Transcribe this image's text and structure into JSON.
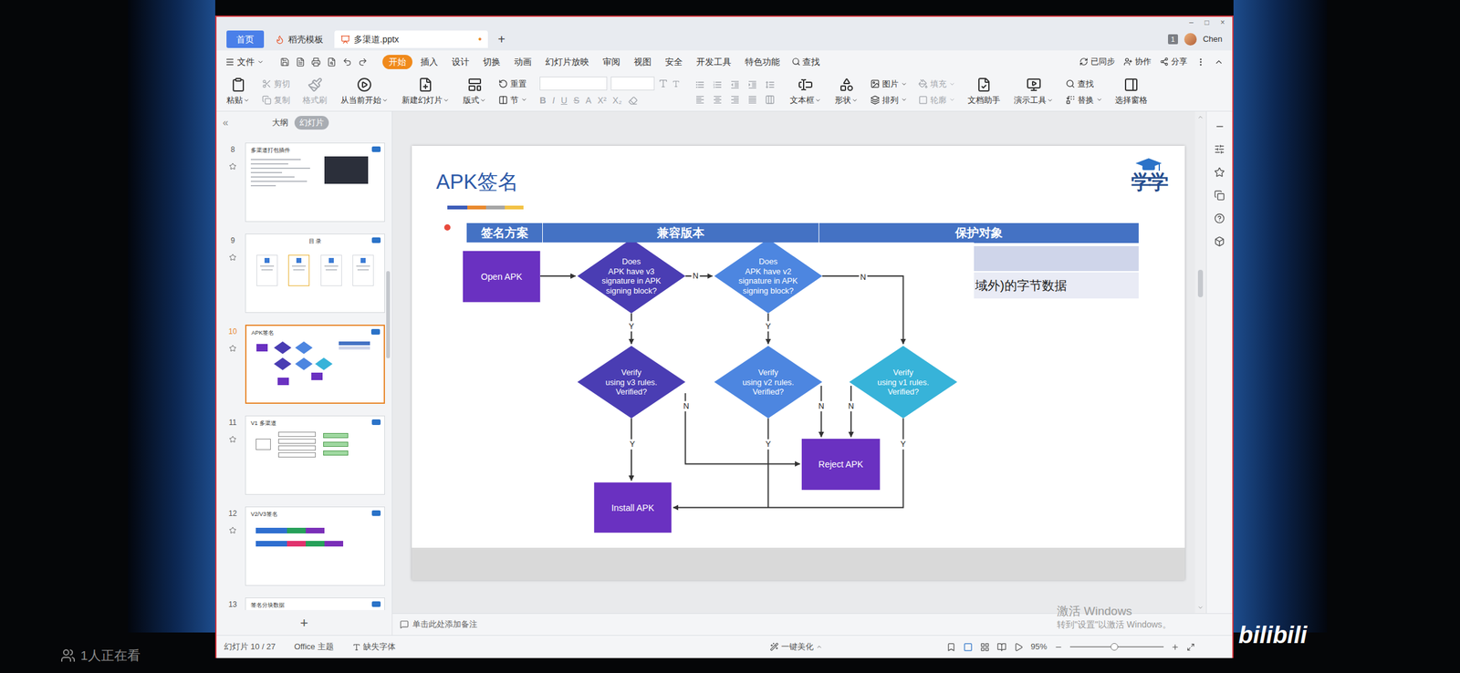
{
  "stream": {
    "viewers": "1人正在看",
    "logo": "bilibili",
    "watermark": [
      "激活 Windows",
      "转到\"设置\"以激活 Windows。"
    ]
  },
  "window": {
    "tabs": [
      {
        "label": "首页",
        "kind": "home",
        "selected": false
      },
      {
        "label": "稻壳模板",
        "kind": "template",
        "selected": false
      },
      {
        "label": "多渠道.pptx",
        "kind": "doc",
        "selected": true
      }
    ],
    "modified": "•",
    "new_tab": "+",
    "badge": "1",
    "user": "Chen",
    "controls": [
      "–",
      "□",
      "×"
    ]
  },
  "menu": {
    "file": "文件",
    "items": [
      {
        "label": "开始",
        "selected": true
      },
      {
        "label": "插入",
        "selected": false
      },
      {
        "label": "设计",
        "selected": false
      },
      {
        "label": "切换",
        "selected": false
      },
      {
        "label": "动画",
        "selected": false
      },
      {
        "label": "幻灯片放映",
        "selected": false
      },
      {
        "label": "审阅",
        "selected": false
      },
      {
        "label": "视图",
        "selected": false
      },
      {
        "label": "安全",
        "selected": false
      },
      {
        "label": "开发工具",
        "selected": false
      },
      {
        "label": "特色功能",
        "selected": false
      }
    ],
    "search": "查找",
    "right": [
      "已同步",
      "协作",
      "分享"
    ]
  },
  "ribbon": [
    {
      "kind": "big",
      "items": [
        {
          "label": "粘贴",
          "disabled": false,
          "menu": true
        }
      ]
    },
    {
      "kind": "stack",
      "items": [
        {
          "label": "剪切",
          "disabled": true,
          "menu": false
        },
        {
          "label": "复制",
          "disabled": true,
          "menu": false
        }
      ]
    },
    {
      "kind": "big",
      "items": [
        {
          "label": "格式刷",
          "disabled": true,
          "menu": false
        }
      ]
    },
    {
      "kind": "big",
      "items": [
        {
          "label": "从当前开始",
          "disabled": false,
          "menu": true
        }
      ]
    },
    {
      "kind": "big",
      "items": [
        {
          "label": "新建幻灯片",
          "disabled": false,
          "menu": true
        }
      ]
    },
    {
      "kind": "big",
      "items": [
        {
          "label": "版式",
          "disabled": false,
          "menu": true
        }
      ]
    },
    {
      "kind": "stack",
      "items": [
        {
          "label": "重置",
          "disabled": false,
          "menu": false
        },
        {
          "label": "节",
          "disabled": false,
          "menu": true
        }
      ]
    },
    {
      "kind": "font",
      "format": [
        "B",
        "I",
        "U",
        "S",
        "A",
        "X²",
        "X₂"
      ],
      "disabled": true
    },
    {
      "kind": "paragraph",
      "disabled": true
    },
    {
      "kind": "big",
      "items": [
        {
          "label": "文本框",
          "disabled": false,
          "menu": true
        }
      ]
    },
    {
      "kind": "big",
      "items": [
        {
          "label": "形状",
          "disabled": false,
          "menu": true
        }
      ]
    },
    {
      "kind": "stack",
      "items": [
        {
          "label": "图片",
          "disabled": false,
          "menu": true
        },
        {
          "label": "排列",
          "disabled": false,
          "menu": true
        }
      ]
    },
    {
      "kind": "stack",
      "items": [
        {
          "label": "填充",
          "disabled": true,
          "menu": true
        },
        {
          "label": "轮廓",
          "disabled": true,
          "menu": true
        }
      ]
    },
    {
      "kind": "big",
      "items": [
        {
          "label": "文档助手",
          "disabled": false,
          "menu": false
        }
      ]
    },
    {
      "kind": "big",
      "items": [
        {
          "label": "演示工具",
          "disabled": false,
          "menu": true
        }
      ]
    },
    {
      "kind": "stack",
      "items": [
        {
          "label": "查找",
          "disabled": false,
          "menu": false
        },
        {
          "label": "替换",
          "disabled": false,
          "menu": true
        }
      ]
    },
    {
      "kind": "big",
      "items": [
        {
          "label": "选择窗格",
          "disabled": false,
          "menu": false
        }
      ]
    }
  ],
  "panel": {
    "collapse": "«",
    "tabs": [
      {
        "label": "大纲",
        "selected": false
      },
      {
        "label": "幻灯片",
        "selected": true
      }
    ],
    "slides": [
      {
        "number": "8",
        "title": "多渠道打包插件",
        "kind": "code",
        "selected": false,
        "animated": true
      },
      {
        "number": "9",
        "title": "目 录",
        "kind": "toc",
        "selected": false,
        "animated": true
      },
      {
        "number": "10",
        "title": "APK签名",
        "kind": "flow",
        "selected": true,
        "animated": true
      },
      {
        "number": "11",
        "title": "V1 多渠道",
        "kind": "diagram",
        "selected": false,
        "animated": true
      },
      {
        "number": "12",
        "title": "V2/V3签名",
        "kind": "bars",
        "selected": false,
        "animated": true
      },
      {
        "number": "13",
        "title": "签名分块数据",
        "kind": "plain",
        "selected": false,
        "animated": false
      }
    ],
    "add": "+"
  },
  "slide": {
    "title": "APK签名",
    "logo": "学学",
    "table": {
      "columns": [
        "签名方案",
        "兼容版本",
        "保护对象"
      ],
      "visible_cell": "域外)的字节数据"
    },
    "flowchart": {
      "nodes": [
        {
          "kind": "process",
          "lines": [
            "Open APK"
          ],
          "color": "#6a31c1"
        },
        {
          "kind": "decision",
          "lines": [
            "Does",
            "APK have v3",
            "signature in APK",
            "signing block?"
          ],
          "color": "#4a3db3"
        },
        {
          "kind": "decision",
          "lines": [
            "Does",
            "APK have v2",
            "signature in APK",
            "signing block?"
          ],
          "color": "#4d86e0"
        },
        {
          "kind": "decision",
          "lines": [
            "Verify",
            "using v3 rules.",
            "Verified?"
          ],
          "color": "#4a3db3"
        },
        {
          "kind": "decision",
          "lines": [
            "Verify",
            "using v2 rules.",
            "Verified?"
          ],
          "color": "#4d86e0"
        },
        {
          "kind": "decision",
          "lines": [
            "Verify",
            "using v1 rules.",
            "Verified?"
          ],
          "color": "#37b3d9"
        },
        {
          "kind": "process",
          "lines": [
            "Reject APK"
          ],
          "color": "#6a31c1"
        },
        {
          "kind": "process",
          "lines": [
            "Install APK"
          ],
          "color": "#6a31c1"
        }
      ],
      "edge_labels": [
        "N",
        "N",
        "Y",
        "Y",
        "N",
        "N",
        "N",
        "Y",
        "Y",
        "Y"
      ]
    }
  },
  "notes": {
    "placeholder": "单击此处添加备注"
  },
  "status": {
    "slide": "幻灯片 10 / 27",
    "theme": "Office 主题",
    "fonts": "缺失字体",
    "beautify": "一键美化",
    "zoom": "95%",
    "zoom_level": 0.47
  }
}
